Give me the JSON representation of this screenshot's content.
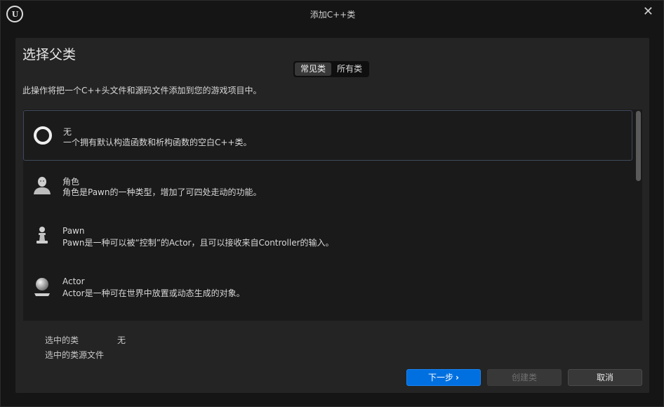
{
  "window": {
    "title": "添加C++类",
    "logo_text": "U"
  },
  "panel": {
    "heading": "选择父类",
    "tabs": [
      {
        "label": "常见类",
        "active": true
      },
      {
        "label": "所有类",
        "active": false
      }
    ],
    "description": "此操作将把一个C++头文件和源码文件添加到您的游戏项目中。"
  },
  "classes": [
    {
      "name": "无",
      "desc": "一个拥有默认构造函数和析构函数的空白C++类。",
      "icon": "empty-ring-icon",
      "selected": true
    },
    {
      "name": "角色",
      "desc": "角色是Pawn的一种类型，增加了可四处走动的功能。",
      "icon": "character-bust-icon",
      "selected": false
    },
    {
      "name": "Pawn",
      "desc": "Pawn是一种可以被“控制”的Actor，且可以接收来自Controller的输入。",
      "icon": "pawn-piece-icon",
      "selected": false
    },
    {
      "name": "Actor",
      "desc": "Actor是一种可在世界中放置或动态生成的对象。",
      "icon": "sphere-on-base-icon",
      "selected": false
    }
  ],
  "selection": {
    "selected_class_label": "选中的类",
    "selected_class_value": "无",
    "source_file_label": "选中的类源文件",
    "source_file_value": ""
  },
  "buttons": {
    "next": "下一步",
    "next_chevron": "›",
    "create": "创建类",
    "cancel": "取消"
  },
  "colors": {
    "accent": "#0070e0",
    "selected_border": "#3e4a5c",
    "panel_bg": "#242424"
  }
}
